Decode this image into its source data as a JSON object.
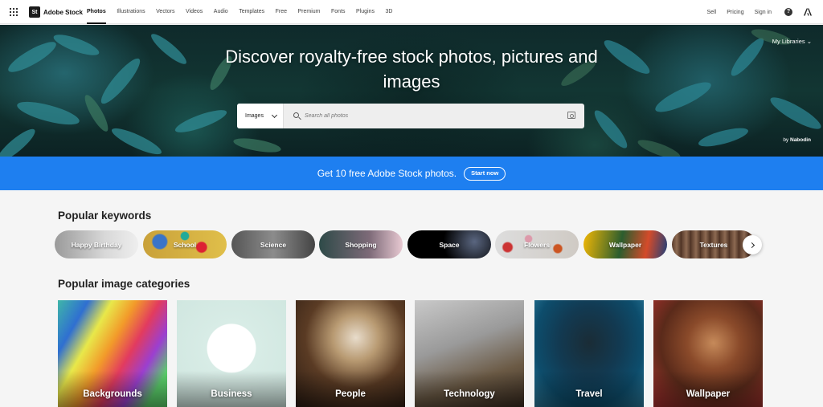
{
  "nav": {
    "brand": "Adobe Stock",
    "brand_mark": "St",
    "links": [
      "Photos",
      "Illustrations",
      "Vectors",
      "Videos",
      "Audio",
      "Templates",
      "Free",
      "Premium",
      "Fonts",
      "Plugins",
      "3D"
    ],
    "active": "Photos",
    "right": {
      "sell": "Sell",
      "pricing": "Pricing",
      "signin": "Sign in",
      "help": "?"
    }
  },
  "hero": {
    "title": "Discover royalty-free stock photos, pictures and images",
    "my_libraries": "My Libraries",
    "credit_by": "by",
    "credit_name": "Nabodin",
    "search": {
      "type": "Images",
      "placeholder": "Search all photos"
    }
  },
  "promo": {
    "text": "Get 10 free Adobe Stock photos.",
    "button": "Start now"
  },
  "keywords": {
    "title": "Popular keywords",
    "items": [
      "Happy Birthday",
      "School",
      "Science",
      "Shopping",
      "Space",
      "Flowers",
      "Wallpaper",
      "Textures"
    ]
  },
  "categories": {
    "title": "Popular image categories",
    "items": [
      "Backgrounds",
      "Business",
      "People",
      "Technology",
      "Travel",
      "Wallpaper"
    ]
  },
  "colors": {
    "promo_blue": "#1e7ff0",
    "hero_dark": "#0f2a2b",
    "text_dark": "#222222"
  },
  "icons": [
    "apps-grid-icon",
    "search-icon",
    "camera-icon",
    "chevron-down-icon",
    "help-icon",
    "adobe-logo-icon",
    "chevron-right-icon"
  ]
}
